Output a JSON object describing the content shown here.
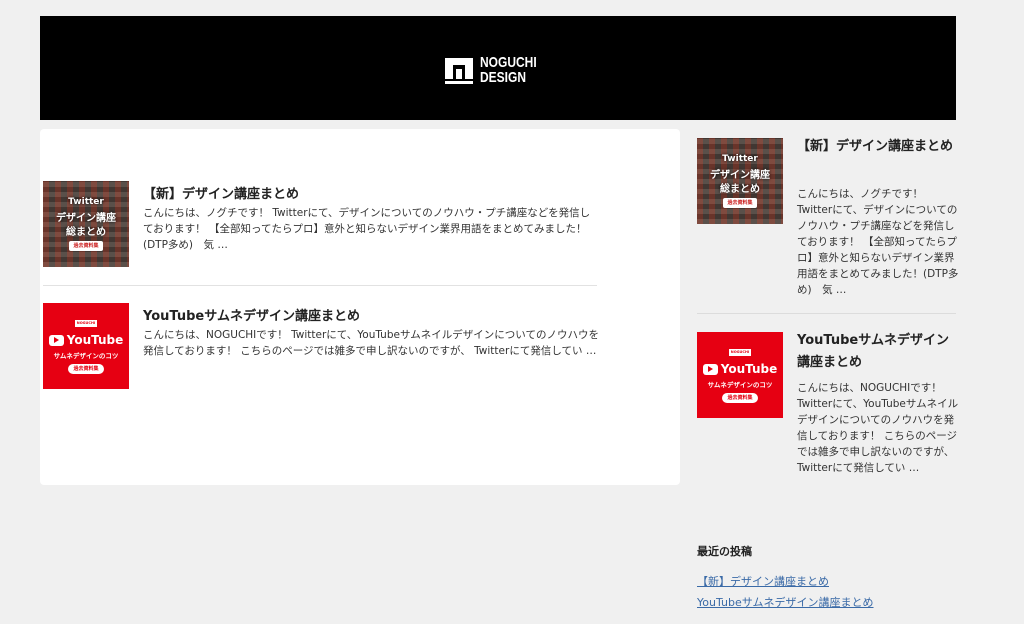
{
  "header": {
    "logo_line1": "NOGUCHI",
    "logo_line2": "DESIGN",
    "background": "#000000"
  },
  "posts": [
    {
      "title": "【新】デザイン講座まとめ",
      "excerpt": "こんにちは、ノグチです！ Twitterにて、デザインについてのノウハウ・プチ講座などを発信しております！ 【全部知ってたらプロ】意外と知らないデザイン業界用語をまとめてみました！(DTP多め)　気 …",
      "thumb": {
        "line1": "Twitter",
        "line2": "デザイン講座",
        "line3": "総まとめ",
        "badge": "過去資料集"
      }
    },
    {
      "title": "YouTubeサムネデザイン講座まとめ",
      "excerpt": "こんにちは、NOGUCHIです！ Twitterにて、YouTubeサムネイルデザインについてのノウハウを発信しております！ こちらのページでは雑多で申し訳ないのですが、 Twitterにて発信してい …",
      "thumb": {
        "brand": "NOGUCHI DESIGN",
        "logo": "YouTube",
        "sub": "サムネデザインのコツ",
        "badge": "過去資料集"
      }
    }
  ],
  "sidebar": {
    "posts": [
      {
        "title": "【新】デザイン講座まとめ",
        "excerpt": "こんにちは、ノグチです！ Twitterにて、デザインについてのノウハウ・プチ講座などを発信しております！ 【全部知ってたらプロ】意外と知らないデザイン業界用語をまとめてみました！(DTP多め)　気 …"
      },
      {
        "title": "YouTubeサムネデザイン講座まとめ",
        "excerpt": "こんにちは、NOGUCHIです！ Twitterにて、YouTubeサムネイルデザインについてのノウハウを発信しております！ こちらのページでは雑多で申し訳ないのですが、 Twitterにて発信してい …"
      }
    ],
    "recent_heading": "最近の投稿",
    "recent_links": [
      "【新】デザイン講座まとめ",
      "YouTubeサムネデザイン講座まとめ"
    ]
  },
  "colors": {
    "page_bg": "#f0f0f0",
    "link": "#3a6aa7",
    "youtube_red": "#e60012"
  }
}
